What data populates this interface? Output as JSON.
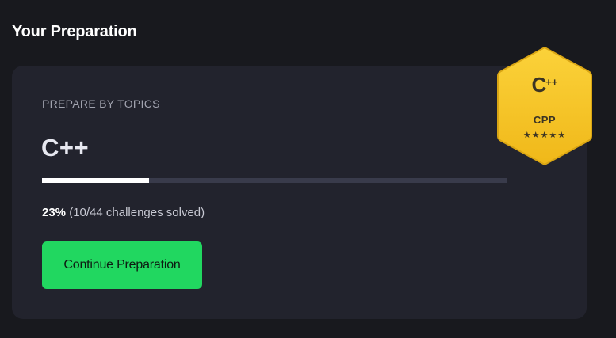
{
  "section": {
    "title": "Your Preparation"
  },
  "card": {
    "kicker": "PREPARE BY TOPICS",
    "topic": "C++",
    "progress": {
      "fraction": 0.23,
      "percent_label": "23%",
      "detail": "(10/44 challenges solved)"
    },
    "continue_label": "Continue Preparation"
  },
  "badge": {
    "logo_letter": "C",
    "logo_suffix": "++",
    "label": "CPP",
    "stars": "★★★★★",
    "star_count": 5,
    "fill_color": "#f6c31f",
    "border_color": "#d9a514",
    "icon": "cpp-badge-icon"
  },
  "colors": {
    "page_background": "#18191e",
    "card_background": "#22232d",
    "button_green": "#21d760",
    "progress_track": "#393b4b",
    "progress_fill": "#ffffff"
  }
}
